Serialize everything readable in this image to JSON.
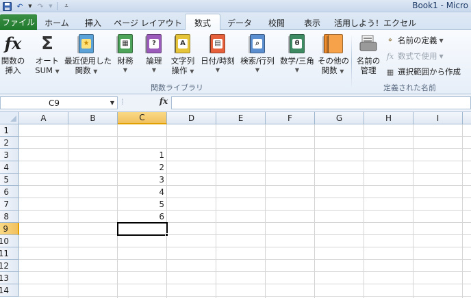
{
  "title_bar": {
    "title": "Book1 - Micro"
  },
  "quick_access": {
    "save_icon": "save-icon",
    "undo_icon": "undo-icon",
    "redo_icon": "redo-icon"
  },
  "tabs": {
    "file": "ファイル",
    "items": [
      "ホーム",
      "挿入",
      "ページ レイアウト",
      "数式",
      "データ",
      "校閲",
      "表示",
      "活用しよう！エクセル"
    ],
    "active": "数式"
  },
  "ribbon": {
    "library": {
      "insert_function": [
        "関数の",
        "挿入"
      ],
      "autosum": [
        "オート",
        "SUM"
      ],
      "recent": [
        "最近使用した",
        "関数"
      ],
      "financial": "財務",
      "logical": "論理",
      "text": [
        "文字列",
        "操作"
      ],
      "datetime": "日付/時刻",
      "lookup": "検索/行列",
      "math": "数学/三角",
      "more": [
        "その他の",
        "関数"
      ],
      "group_label": "関数ライブラリ"
    },
    "names": {
      "name_manager": [
        "名前の",
        "管理"
      ],
      "define_name": "名前の定義",
      "use_in_formula": "数式で使用",
      "create_from_selection": "選択範囲から作成",
      "group_label": "定義された名前"
    }
  },
  "formula_bar": {
    "name_box": "C9",
    "fx": "fx",
    "formula": ""
  },
  "sheet": {
    "columns": [
      "A",
      "B",
      "C",
      "D",
      "E",
      "F",
      "G",
      "H",
      "I"
    ],
    "rows": [
      "1",
      "2",
      "3",
      "4",
      "5",
      "6",
      "7",
      "8",
      "9",
      "10",
      "11",
      "12",
      "13",
      "14"
    ],
    "selected_column": "C",
    "selected_row": "9",
    "cells": {
      "C3": "1",
      "C4": "2",
      "C5": "3",
      "C6": "4",
      "C7": "5",
      "C8": "6"
    }
  }
}
